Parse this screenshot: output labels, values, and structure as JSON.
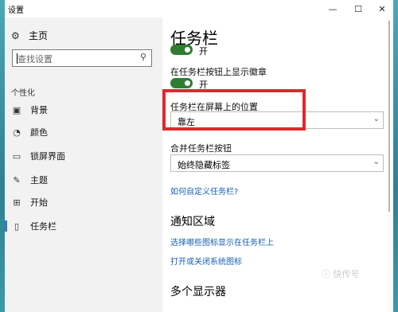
{
  "window": {
    "title": "设置",
    "controls": {
      "minimize": "—",
      "maximize": "☐",
      "close": "✕"
    }
  },
  "sidebar": {
    "home_label": "主页",
    "search": {
      "placeholder": "查找设置"
    },
    "group_label": "个性化",
    "items": [
      {
        "label": "背景",
        "icon": "image-icon",
        "glyph": "▣"
      },
      {
        "label": "颜色",
        "icon": "palette-icon",
        "glyph": "◔"
      },
      {
        "label": "锁屏界面",
        "icon": "lock-screen-icon",
        "glyph": "▭"
      },
      {
        "label": "主题",
        "icon": "theme-icon",
        "glyph": "✎"
      },
      {
        "label": "开始",
        "icon": "start-icon",
        "glyph": "⊞"
      },
      {
        "label": "任务栏",
        "icon": "taskbar-icon",
        "glyph": "▯",
        "active": true
      }
    ]
  },
  "main": {
    "title": "任务栏",
    "toggle1": {
      "state": "开"
    },
    "badge_setting": {
      "label": "在任务栏按钮上显示徽章",
      "state": "开"
    },
    "position_setting": {
      "label": "任务栏在屏幕上的位置",
      "value": "靠左"
    },
    "combine_setting": {
      "label": "合并任务栏按钮",
      "value": "始终隐藏标签"
    },
    "customize_link": "如何自定义任务栏?",
    "notification": {
      "heading": "通知区域",
      "link1": "选择哪些图标显示在任务栏上",
      "link2": "打开或关闭系统图标"
    },
    "multi_display_heading": "多个显示器"
  },
  "colors": {
    "accent": "#3b78c4",
    "toggle_on": "#2e7d32",
    "link": "#1a5fb4",
    "highlight_box": "#e3262e"
  },
  "watermark": "ⓘ 快传号"
}
